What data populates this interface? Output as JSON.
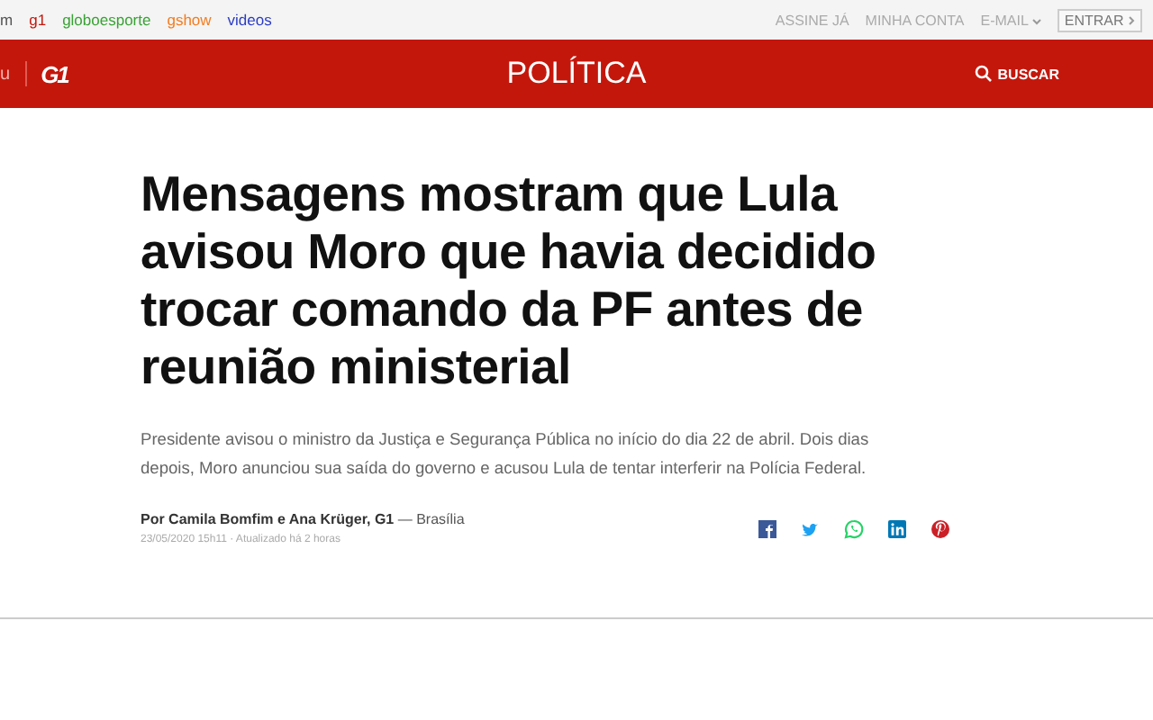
{
  "globo_bar": {
    "sites": [
      {
        "label": "m",
        "color": "#555555"
      },
      {
        "label": "g1",
        "color": "#c4170c"
      },
      {
        "label": "globoesporte",
        "color": "#39a235"
      },
      {
        "label": "gshow",
        "color": "#f47b20"
      },
      {
        "label": "videos",
        "color": "#2c3cc4"
      }
    ],
    "account_links": [
      {
        "label": "ASSINE JÁ",
        "kind": "link"
      },
      {
        "label": "MINHA CONTA",
        "kind": "link"
      },
      {
        "label": "E-MAIL",
        "kind": "dropdown"
      },
      {
        "label": "ENTRAR",
        "kind": "button"
      }
    ]
  },
  "header": {
    "menu_label": "u",
    "logo": "G1",
    "section": "POLÍTICA",
    "search_label": "BUSCAR"
  },
  "article": {
    "headline": "Mensagens mostram que Lula avisou Moro que havia decidido trocar comando da PF antes de reunião ministerial",
    "subtitle": "Presidente avisou o ministro da Justiça e Segurança Pública no início do dia 22 de abril. Dois dias depois, Moro anunciou sua saída do governo e acusou Lula de tentar interferir na Polícia Federal.",
    "byline": "**Por Camila Bomfim e Ana Krüger, G1** — Brasília",
    "dateline": "23/05/2020 15h11 · Atualizado há 2 horas",
    "share": [
      {
        "kind": "facebook"
      },
      {
        "kind": "twitter"
      },
      {
        "kind": "whatsapp"
      },
      {
        "kind": "linkedin"
      },
      {
        "kind": "pinterest"
      }
    ]
  }
}
